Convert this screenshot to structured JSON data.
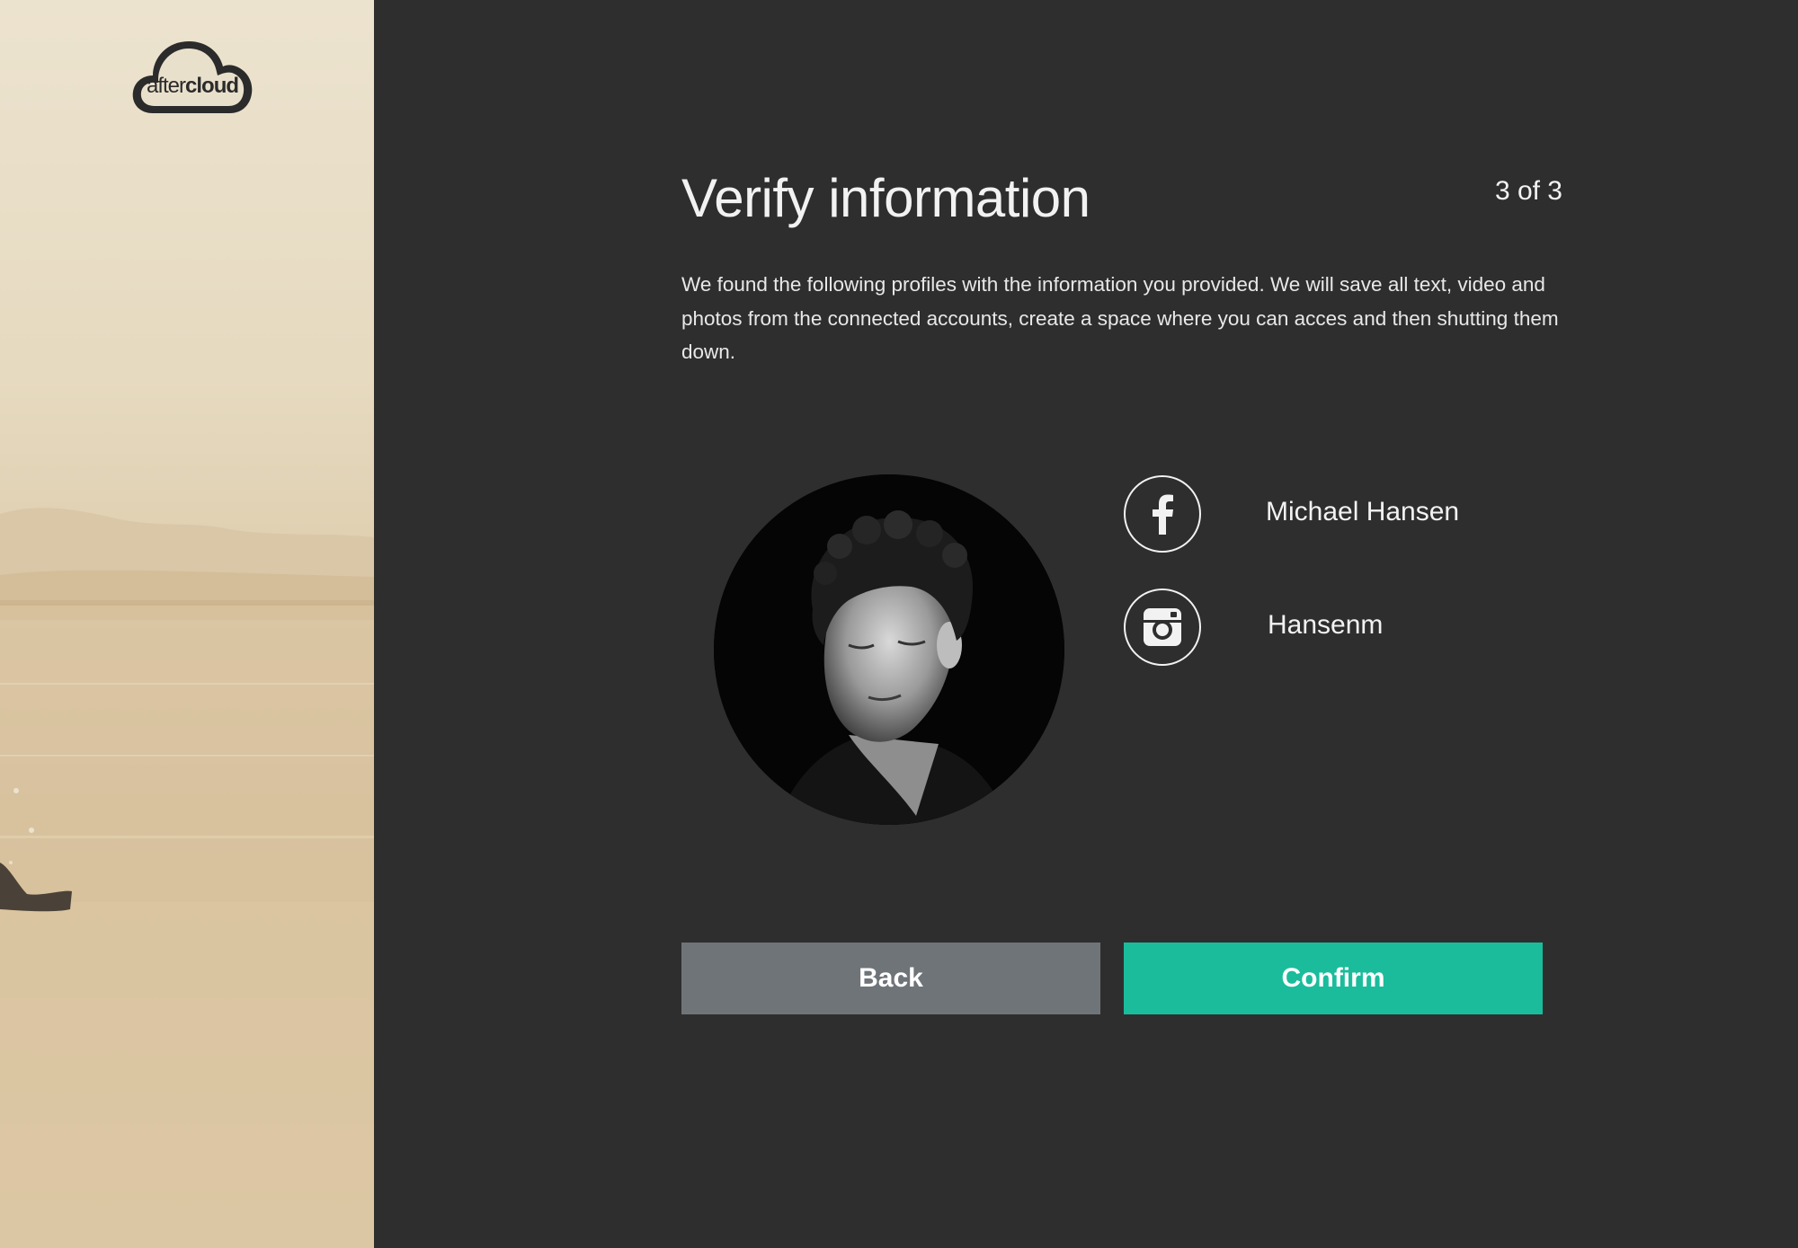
{
  "brand": {
    "logo_light": "after",
    "logo_bold": "cloud"
  },
  "header": {
    "title": "Verify information",
    "step": "3 of 3"
  },
  "description": "We found the following  profiles with the information you provided. We will save all text, video and photos from the connected accounts, create a space where you can acces  and then shutting  them down.",
  "profiles": [
    {
      "network": "facebook",
      "icon": "facebook-icon",
      "name": "Michael Hansen"
    },
    {
      "network": "instagram",
      "icon": "instagram-icon",
      "name": "Hansenm"
    }
  ],
  "actions": {
    "back_label": "Back",
    "confirm_label": "Confirm"
  },
  "colors": {
    "background": "#2e2e2e",
    "accent": "#1abc9c",
    "secondary_button": "#6f7479",
    "text": "#f2f2f2"
  }
}
